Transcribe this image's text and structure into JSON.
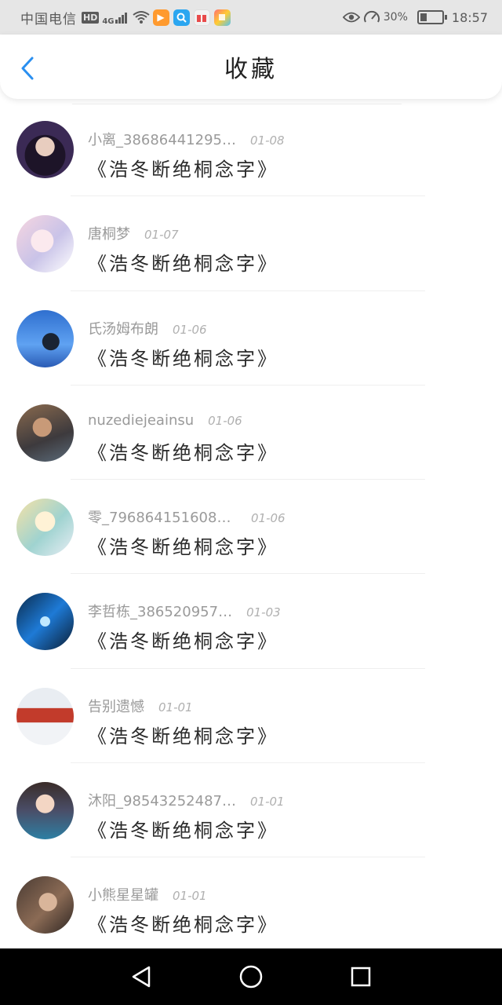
{
  "status_bar": {
    "carrier": "中国电信",
    "hd": "HD",
    "network": "4G",
    "battery_percent": "30%",
    "battery_level": 0.3,
    "time": "18:57",
    "icons": [
      "signal-icon",
      "wifi-icon",
      "video-app-icon",
      "search-app-icon",
      "gift-app-icon",
      "store-app-icon",
      "eye-icon",
      "speed-icon",
      "battery-icon"
    ]
  },
  "header": {
    "title": "收藏",
    "back_icon": "chevron-left-icon"
  },
  "colors": {
    "accent": "#2a8ff0",
    "status_bar_bg": "#e6e6e6",
    "nav_bar_bg": "#000000"
  },
  "favorites": [
    {
      "author": "小离_38686441295…",
      "date": "01-08",
      "book": "《浩冬断绝桐念字》",
      "avatar": "avatar-dark-hair-girl"
    },
    {
      "author": "唐桐梦",
      "date": "01-07",
      "book": "《浩冬断绝桐念字》",
      "avatar": "avatar-anime-pink"
    },
    {
      "author": "氏汤姆布朗",
      "date": "01-06",
      "book": "《浩冬断绝桐念字》",
      "avatar": "avatar-blue-sky-person"
    },
    {
      "author": "nuzediejeainsu",
      "date": "01-06",
      "book": "《浩冬断绝桐念字》",
      "avatar": "avatar-man-striped"
    },
    {
      "author": "零_79686415160869…",
      "date": "01-06",
      "book": "《浩冬断绝桐念字》",
      "avatar": "avatar-anime-blonde"
    },
    {
      "author": "李哲栋_386520957…",
      "date": "01-03",
      "book": "《浩冬断绝桐念字》",
      "avatar": "avatar-blue-action"
    },
    {
      "author": "告别遗憾",
      "date": "01-01",
      "book": "《浩冬断绝桐念字》",
      "avatar": "avatar-train"
    },
    {
      "author": "沐阳_98543252487…",
      "date": "01-01",
      "book": "《浩冬断绝桐念字》",
      "avatar": "avatar-anime-boy-scarf"
    },
    {
      "author": "小熊星星罐",
      "date": "01-01",
      "book": "《浩冬断绝桐念字》",
      "avatar": "avatar-selfie-girl"
    }
  ],
  "nav_bar": {
    "back_icon": "triangle-back-icon",
    "home_icon": "circle-home-icon",
    "recents_icon": "square-recents-icon"
  }
}
